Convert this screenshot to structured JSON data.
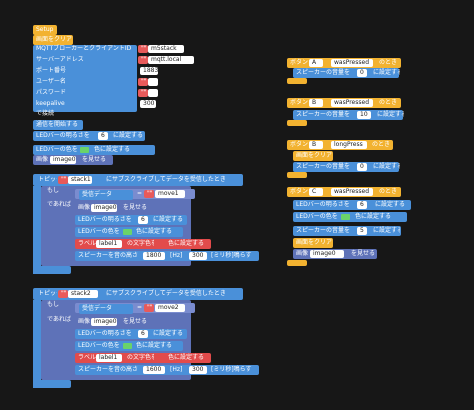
{
  "setup": {
    "hat": "Setup",
    "clear": "画面をクリア",
    "broker_label": "MQTTブローカーとクライアントID",
    "broker_q": "\"\"",
    "broker_val": "m5stack",
    "server_label": "サーバーアドレス",
    "server_q": "\"\"",
    "server_val": "mqtt.local",
    "port_label": "ポート番号",
    "port_val": "1883",
    "user_label": "ユーザー名",
    "user_q": "\"\"",
    "pass_label": "パスワード",
    "pass_q": "\"\"",
    "keepalive_label": "keepalive",
    "keepalive_val": "300",
    "connect": "で接続",
    "start": "通信を開始する",
    "led_brightness": "LEDバーの明るさを",
    "led_brightness_val": "6",
    "set": "に設定する",
    "led_color_label": "LEDバーの色を",
    "color_set": "色に設定する",
    "image_prefix": "画像",
    "image_val": "image0",
    "show": "を見せる"
  },
  "topic1": {
    "topic_label": "トピック",
    "topic_val": "stack1",
    "topic_suffix": "にサブスクライブしてデータを受信したとき",
    "if_label": "もし",
    "then_label": "であれば",
    "recv": "受信データ",
    "eq": "=",
    "move_val": "move1",
    "image_prefix": "画像",
    "image_val": "image0",
    "show": "を見せる",
    "led_brightness": "LEDバーの明るさを",
    "led_val": "6",
    "set": "に設定する",
    "led_color": "LEDバーの色を",
    "color_set": "色に設定する",
    "label_prefix": "ラベル",
    "label_val": "label1",
    "label_color": "の文字色を",
    "speaker": "スピーカーを音の高さ",
    "hz_val": "1800",
    "hz": "[Hz]",
    "ms_val": "300",
    "ms": "[ミリ秒]鳴らす"
  },
  "topic2": {
    "topic_label": "トピック",
    "topic_val": "stack2",
    "topic_suffix": "にサブスクライブしてデータを受信したとき",
    "if_label": "もし",
    "then_label": "であれば",
    "recv": "受信データ",
    "eq": "=",
    "move_val": "move2",
    "image_prefix": "画像",
    "image_val": "image0",
    "show": "を見せる",
    "led_brightness": "LEDバーの明るさを",
    "led_val": "6",
    "set": "に設定する",
    "led_color": "LEDバーの色を",
    "color_set": "色に設定する",
    "label_prefix": "ラベル",
    "label_val": "label1",
    "label_color": "の文字色を",
    "speaker": "スピーカーを音の高さ",
    "hz_val": "1600",
    "hz": "[Hz]",
    "ms_val": "300",
    "ms": "[ミリ秒]鳴らす"
  },
  "btnA": {
    "prefix": "ボタン",
    "btn": "A",
    "event": "wasPressed",
    "suffix": "のとき",
    "speaker_vol": "スピーカーの音量を",
    "vol": "0",
    "set": "に設定する"
  },
  "btnB": {
    "prefix": "ボタン",
    "btn": "B",
    "event": "wasPressed",
    "suffix": "のとき",
    "speaker_vol": "スピーカーの音量を",
    "vol": "10",
    "set": "に設定する"
  },
  "btnBlong": {
    "prefix": "ボタン",
    "btn": "B",
    "event": "longPress",
    "suffix": "のとき",
    "clear": "画面をクリア",
    "speaker_vol": "スピーカーの音量を",
    "vol": "0",
    "set": "に設定する"
  },
  "btnC": {
    "prefix": "ボタン",
    "btn": "C",
    "event": "wasPressed",
    "suffix": "のとき",
    "led_brightness": "LEDバーの明るさを",
    "led_val": "6",
    "set": "に設定する",
    "led_color": "LEDバーの色を",
    "color_set": "色に設定する",
    "speaker_vol": "スピーカーの音量を",
    "vol": "5",
    "clear": "画面をクリア",
    "image_prefix": "画像",
    "image_val": "image0",
    "show": "を見せる"
  },
  "colors": {
    "event": "#f2b230",
    "action": "#4a90d9",
    "logic": "#5e72b8",
    "label": "#e24b4b",
    "led_green": "#6ad36a"
  }
}
